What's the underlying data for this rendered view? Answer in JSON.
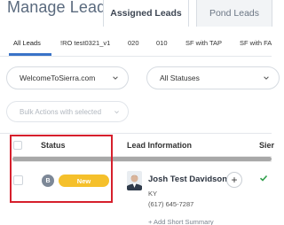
{
  "header": {
    "title": "Manage Leads",
    "tabs": [
      {
        "label": "Assigned Leads",
        "active": true
      },
      {
        "label": "Pond Leads",
        "active": false
      }
    ]
  },
  "filter_chips": [
    {
      "label": "All Leads",
      "active": true
    },
    {
      "label": "!RO test0321_v1",
      "active": false
    },
    {
      "label": "020",
      "active": false
    },
    {
      "label": "010",
      "active": false
    },
    {
      "label": "SF with TAP",
      "active": false
    },
    {
      "label": "SF with FA",
      "active": false
    }
  ],
  "filters": {
    "site_select": "WelcomeToSierra.com",
    "status_select": "All Statuses",
    "bulk_actions": "Bulk Actions with selected"
  },
  "table": {
    "columns": [
      "Status",
      "Lead Information",
      "Sier"
    ],
    "rows": [
      {
        "badge": "B",
        "status": "New",
        "name": "Josh Test Davidson",
        "state": "KY",
        "phone": "(617) 645-7287",
        "summary_link": "+ Add Short Summary"
      }
    ]
  },
  "colors": {
    "accent": "#3a73c8",
    "status_new": "#f5c02b",
    "highlight": "#d61f2c",
    "check": "#2e9e4a"
  }
}
